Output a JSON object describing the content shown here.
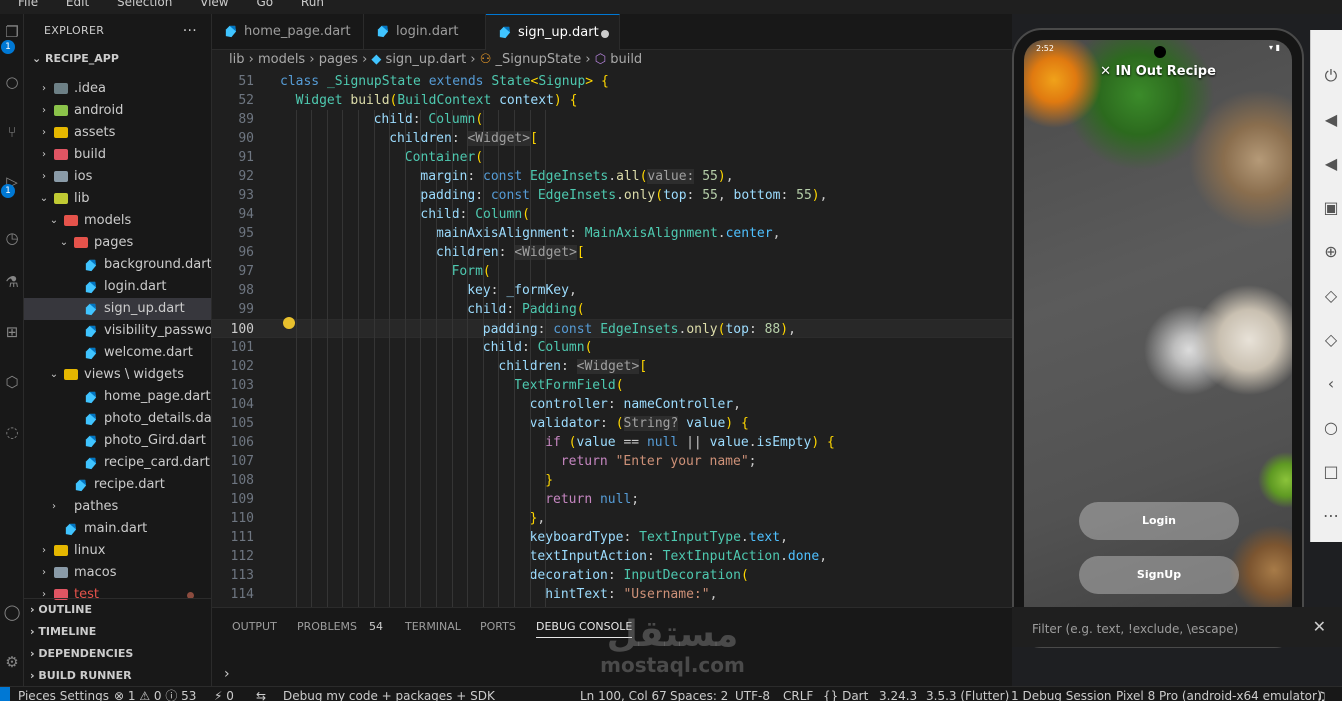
{
  "menu": [
    "File",
    "Edit",
    "Selection",
    "View",
    "Go",
    "Run"
  ],
  "explorer": {
    "title": "EXPLORER",
    "more_icon": "ellipsis-icon",
    "project": "RECIPE_APP",
    "items": [
      {
        "label": ".idea",
        "indent": 1,
        "chevron": "›",
        "icon": "folder",
        "color": "#6d8086"
      },
      {
        "label": "android",
        "indent": 1,
        "chevron": "›",
        "icon": "folder",
        "color": "#8bc34a"
      },
      {
        "label": "assets",
        "indent": 1,
        "chevron": "›",
        "icon": "folder",
        "color": "#e5b700"
      },
      {
        "label": "build",
        "indent": 1,
        "chevron": "›",
        "icon": "folder",
        "color": "#e05563"
      },
      {
        "label": "ios",
        "indent": 1,
        "chevron": "›",
        "icon": "folder",
        "color": "#8a9ba8"
      },
      {
        "label": "lib",
        "indent": 1,
        "chevron": "⌄",
        "icon": "folder",
        "color": "#c0ca33"
      },
      {
        "label": "models",
        "indent": 2,
        "chevron": "⌄",
        "icon": "folder",
        "color": "#e5534b"
      },
      {
        "label": "pages",
        "indent": 3,
        "chevron": "⌄",
        "icon": "folder",
        "color": "#e5534b"
      },
      {
        "label": "background.dart",
        "indent": 4,
        "icon": "dart"
      },
      {
        "label": "login.dart",
        "indent": 4,
        "icon": "dart"
      },
      {
        "label": "sign_up.dart",
        "indent": 4,
        "icon": "dart",
        "selected": true
      },
      {
        "label": "visibility_passwor...",
        "indent": 4,
        "icon": "dart"
      },
      {
        "label": "welcome.dart",
        "indent": 4,
        "icon": "dart"
      },
      {
        "label": "views \\ widgets",
        "indent": 2,
        "chevron": "⌄",
        "icon": "folder",
        "color": "#e5b700"
      },
      {
        "label": "home_page.dart",
        "indent": 4,
        "icon": "dart"
      },
      {
        "label": "photo_details.dart",
        "indent": 4,
        "icon": "dart"
      },
      {
        "label": "photo_Gird.dart",
        "indent": 4,
        "icon": "dart"
      },
      {
        "label": "recipe_card.dart",
        "indent": 4,
        "icon": "dart"
      },
      {
        "label": "recipe.dart",
        "indent": 3,
        "icon": "dart"
      },
      {
        "label": "pathes",
        "indent": 2,
        "chevron": "›",
        "icon": "none"
      },
      {
        "label": "main.dart",
        "indent": 2,
        "icon": "dart"
      },
      {
        "label": "linux",
        "indent": 1,
        "chevron": "›",
        "icon": "folder",
        "color": "#e5b700"
      },
      {
        "label": "macos",
        "indent": 1,
        "chevron": "›",
        "icon": "folder",
        "color": "#8a9ba8"
      },
      {
        "label": "test",
        "indent": 1,
        "chevron": "›",
        "icon": "folder",
        "color": "#e05563",
        "status": "modified"
      }
    ],
    "sections": [
      "OUTLINE",
      "TIMELINE",
      "DEPENDENCIES",
      "BUILD RUNNER"
    ]
  },
  "activity_badges": [
    "1",
    "1"
  ],
  "tabs": [
    {
      "label": "home_page.dart",
      "active": false
    },
    {
      "label": "login.dart",
      "active": false
    },
    {
      "label": "sign_up.dart",
      "active": true,
      "modified": true
    }
  ],
  "breadcrumb": [
    "lib",
    "models",
    "pages",
    "sign_up.dart",
    "_SignupState",
    "build"
  ],
  "code": {
    "current_line": "100",
    "lines": [
      {
        "n": "51",
        "indent": 0,
        "html": "<span class='k'>class</span> <span class='t'>_SignupState</span> <span class='k'>extends</span> <span class='t'>State</span><span class='p'>&lt;</span><span class='t'>Signup</span><span class='p'>&gt;</span> <span class='p'>{</span>"
      },
      {
        "n": "52",
        "indent": 1,
        "html": "<span class='t'>Widget</span> <span class='f'>build</span><span class='p'>(</span><span class='t'>BuildContext</span> <span class='v'>context</span><span class='p'>)</span> <span class='p'>{</span>"
      },
      {
        "n": "89",
        "indent": 6,
        "html": "<span class='v'>child</span>: <span class='t'>Column</span><span class='p'>(</span>"
      },
      {
        "n": "90",
        "indent": 7,
        "html": "<span class='v'>children</span>: <span class='ih'>&lt;</span><span class='t ih'>Widget</span><span class='ih'>&gt;</span><span class='p'>[</span>"
      },
      {
        "n": "91",
        "indent": 8,
        "html": "<span class='t'>Container</span><span class='p'>(</span>"
      },
      {
        "n": "92",
        "indent": 9,
        "html": "<span class='v'>margin</span>: <span class='k'>const</span> <span class='t'>EdgeInsets</span>.<span class='f'>all</span><span class='p'>(</span><span class='ih'>value:</span> <span class='n'>55</span><span class='p'>)</span>,"
      },
      {
        "n": "93",
        "indent": 9,
        "html": "<span class='v'>padding</span>: <span class='k'>const</span> <span class='t'>EdgeInsets</span>.<span class='f'>only</span><span class='p'>(</span><span class='v'>top</span>: <span class='n'>55</span>, <span class='v'>bottom</span>: <span class='n'>55</span><span class='p'>)</span>,"
      },
      {
        "n": "94",
        "indent": 9,
        "html": "<span class='v'>child</span>: <span class='t'>Column</span><span class='p'>(</span>"
      },
      {
        "n": "95",
        "indent": 10,
        "html": "<span class='v'>mainAxisAlignment</span>: <span class='t'>MainAxisAlignment</span>.<span class='cn'>center</span>,"
      },
      {
        "n": "96",
        "indent": 10,
        "html": "<span class='v'>children</span>: <span class='ih'>&lt;</span><span class='t ih'>Widget</span><span class='ih'>&gt;</span><span class='p'>[</span>"
      },
      {
        "n": "97",
        "indent": 11,
        "html": "<span class='t'>Form</span><span class='p'>(</span>"
      },
      {
        "n": "98",
        "indent": 12,
        "html": "<span class='v'>key</span>: <span class='v'>_formKey</span>,"
      },
      {
        "n": "99",
        "indent": 12,
        "html": "<span class='v'>child</span>: <span class='t'>Padding</span><span class='p'>(</span>"
      },
      {
        "n": "100",
        "indent": 13,
        "html": "<span class='v'>padding</span>: <span class='k'>const</span> <span class='t'>EdgeInsets</span>.<span class='f'>only</span><span class='p'>(</span><span class='v'>top</span>: <span class='n'>88</span><span class='p'>)</span>,"
      },
      {
        "n": "101",
        "indent": 13,
        "html": "<span class='v'>child</span>: <span class='t'>Column</span><span class='p'>(</span>"
      },
      {
        "n": "102",
        "indent": 14,
        "html": "<span class='v'>children</span>: <span class='ih'>&lt;</span><span class='t ih'>Widget</span><span class='ih'>&gt;</span><span class='p'>[</span>"
      },
      {
        "n": "103",
        "indent": 15,
        "html": "<span class='t'>TextFormField</span><span class='p'>(</span>"
      },
      {
        "n": "104",
        "indent": 16,
        "html": "<span class='v'>controller</span>: <span class='v'>nameController</span>,"
      },
      {
        "n": "105",
        "indent": 16,
        "html": "<span class='v'>validator</span>: <span class='p'>(</span><span class='ih'>String?</span> <span class='v'>value</span><span class='p'>)</span> <span class='p'>{</span>"
      },
      {
        "n": "106",
        "indent": 17,
        "html": "<span class='kw'>if</span> <span class='p'>(</span><span class='v'>value</span> == <span class='k'>null</span> || <span class='v'>value</span>.<span class='v'>isEmpty</span><span class='p'>)</span> <span class='p'>{</span>"
      },
      {
        "n": "107",
        "indent": 18,
        "html": "<span class='kw'>return</span> <span class='s'>\"Enter your name\"</span>;"
      },
      {
        "n": "108",
        "indent": 17,
        "html": "<span class='p'>}</span>"
      },
      {
        "n": "109",
        "indent": 17,
        "html": "<span class='kw'>return</span> <span class='k'>null</span>;"
      },
      {
        "n": "110",
        "indent": 16,
        "html": "<span class='p'>}</span>,"
      },
      {
        "n": "111",
        "indent": 16,
        "html": "<span class='v'>keyboardType</span>: <span class='t'>TextInputType</span>.<span class='cn'>text</span>,"
      },
      {
        "n": "112",
        "indent": 16,
        "html": "<span class='v'>textInputAction</span>: <span class='t'>TextInputAction</span>.<span class='cn'>done</span>,"
      },
      {
        "n": "113",
        "indent": 16,
        "html": "<span class='v'>decoration</span>: <span class='t'>InputDecoration</span><span class='p'>(</span>"
      },
      {
        "n": "114",
        "indent": 17,
        "html": "<span class='v'>hintText</span>: <span class='s'>\"Username:\"</span>,"
      }
    ]
  },
  "panel": {
    "tabs": [
      {
        "label": "OUTPUT"
      },
      {
        "label": "PROBLEMS",
        "count": "54"
      },
      {
        "label": "TERMINAL"
      },
      {
        "label": "PORTS"
      },
      {
        "label": "DEBUG CONSOLE",
        "active": true
      }
    ],
    "filter_placeholder": "Filter (e.g. text, !exclude, \\escape)",
    "prompt": "›"
  },
  "status": {
    "pieces": "Pieces Settings",
    "problems": "⊗ 1 ⚠ 0 ⓘ 53",
    "ports": "⚡ 0",
    "debug": "Debug my code + packages + SDK",
    "position": "Ln 100, Col 67",
    "spaces": "Spaces: 2",
    "encoding": "UTF-8",
    "eol": "CRLF",
    "language": "{} Dart",
    "dart_version": "3.24.3",
    "flutter_version": "3.5.3 (Flutter)",
    "session": "1 Debug Session",
    "device": "Pixel 8 Pro (android-x64 emulator)"
  },
  "phone": {
    "time": "2:52",
    "app_title": "IN Out Recipe",
    "login_button": "Login",
    "signup_button": "SignUp"
  },
  "watermark": {
    "arabic": "مستقل",
    "latin": "mostaql.com"
  }
}
